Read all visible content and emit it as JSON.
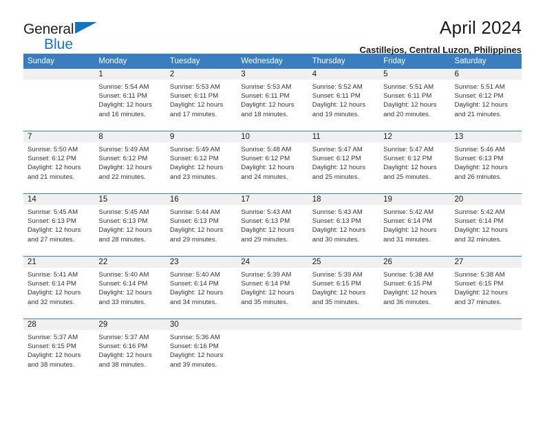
{
  "logo": {
    "word1": "General",
    "word2": "Blue",
    "triangle_icon": "triangle-icon",
    "color_general": "#231f20",
    "color_blue": "#1277c0"
  },
  "header": {
    "title": "April 2024",
    "subtitle": "Castillejos, Central Luzon, Philippines"
  },
  "colors": {
    "header_row_bg": "#3a7ebf",
    "daynum_strip_bg": "#f0f0f0",
    "week_separator": "#3a7ebf"
  },
  "weekdays": [
    "Sunday",
    "Monday",
    "Tuesday",
    "Wednesday",
    "Thursday",
    "Friday",
    "Saturday"
  ],
  "weeks": [
    [
      {
        "day": "",
        "sunrise": "",
        "sunset": "",
        "daylight1": "",
        "daylight2": ""
      },
      {
        "day": "1",
        "sunrise": "Sunrise: 5:54 AM",
        "sunset": "Sunset: 6:11 PM",
        "daylight1": "Daylight: 12 hours",
        "daylight2": "and 16 minutes."
      },
      {
        "day": "2",
        "sunrise": "Sunrise: 5:53 AM",
        "sunset": "Sunset: 6:11 PM",
        "daylight1": "Daylight: 12 hours",
        "daylight2": "and 17 minutes."
      },
      {
        "day": "3",
        "sunrise": "Sunrise: 5:53 AM",
        "sunset": "Sunset: 6:11 PM",
        "daylight1": "Daylight: 12 hours",
        "daylight2": "and 18 minutes."
      },
      {
        "day": "4",
        "sunrise": "Sunrise: 5:52 AM",
        "sunset": "Sunset: 6:11 PM",
        "daylight1": "Daylight: 12 hours",
        "daylight2": "and 19 minutes."
      },
      {
        "day": "5",
        "sunrise": "Sunrise: 5:51 AM",
        "sunset": "Sunset: 6:11 PM",
        "daylight1": "Daylight: 12 hours",
        "daylight2": "and 20 minutes."
      },
      {
        "day": "6",
        "sunrise": "Sunrise: 5:51 AM",
        "sunset": "Sunset: 6:12 PM",
        "daylight1": "Daylight: 12 hours",
        "daylight2": "and 21 minutes."
      }
    ],
    [
      {
        "day": "7",
        "sunrise": "Sunrise: 5:50 AM",
        "sunset": "Sunset: 6:12 PM",
        "daylight1": "Daylight: 12 hours",
        "daylight2": "and 21 minutes."
      },
      {
        "day": "8",
        "sunrise": "Sunrise: 5:49 AM",
        "sunset": "Sunset: 6:12 PM",
        "daylight1": "Daylight: 12 hours",
        "daylight2": "and 22 minutes."
      },
      {
        "day": "9",
        "sunrise": "Sunrise: 5:49 AM",
        "sunset": "Sunset: 6:12 PM",
        "daylight1": "Daylight: 12 hours",
        "daylight2": "and 23 minutes."
      },
      {
        "day": "10",
        "sunrise": "Sunrise: 5:48 AM",
        "sunset": "Sunset: 6:12 PM",
        "daylight1": "Daylight: 12 hours",
        "daylight2": "and 24 minutes."
      },
      {
        "day": "11",
        "sunrise": "Sunrise: 5:47 AM",
        "sunset": "Sunset: 6:12 PM",
        "daylight1": "Daylight: 12 hours",
        "daylight2": "and 25 minutes."
      },
      {
        "day": "12",
        "sunrise": "Sunrise: 5:47 AM",
        "sunset": "Sunset: 6:12 PM",
        "daylight1": "Daylight: 12 hours",
        "daylight2": "and 25 minutes."
      },
      {
        "day": "13",
        "sunrise": "Sunrise: 5:46 AM",
        "sunset": "Sunset: 6:13 PM",
        "daylight1": "Daylight: 12 hours",
        "daylight2": "and 26 minutes."
      }
    ],
    [
      {
        "day": "14",
        "sunrise": "Sunrise: 5:45 AM",
        "sunset": "Sunset: 6:13 PM",
        "daylight1": "Daylight: 12 hours",
        "daylight2": "and 27 minutes."
      },
      {
        "day": "15",
        "sunrise": "Sunrise: 5:45 AM",
        "sunset": "Sunset: 6:13 PM",
        "daylight1": "Daylight: 12 hours",
        "daylight2": "and 28 minutes."
      },
      {
        "day": "16",
        "sunrise": "Sunrise: 5:44 AM",
        "sunset": "Sunset: 6:13 PM",
        "daylight1": "Daylight: 12 hours",
        "daylight2": "and 29 minutes."
      },
      {
        "day": "17",
        "sunrise": "Sunrise: 5:43 AM",
        "sunset": "Sunset: 6:13 PM",
        "daylight1": "Daylight: 12 hours",
        "daylight2": "and 29 minutes."
      },
      {
        "day": "18",
        "sunrise": "Sunrise: 5:43 AM",
        "sunset": "Sunset: 6:13 PM",
        "daylight1": "Daylight: 12 hours",
        "daylight2": "and 30 minutes."
      },
      {
        "day": "19",
        "sunrise": "Sunrise: 5:42 AM",
        "sunset": "Sunset: 6:14 PM",
        "daylight1": "Daylight: 12 hours",
        "daylight2": "and 31 minutes."
      },
      {
        "day": "20",
        "sunrise": "Sunrise: 5:42 AM",
        "sunset": "Sunset: 6:14 PM",
        "daylight1": "Daylight: 12 hours",
        "daylight2": "and 32 minutes."
      }
    ],
    [
      {
        "day": "21",
        "sunrise": "Sunrise: 5:41 AM",
        "sunset": "Sunset: 6:14 PM",
        "daylight1": "Daylight: 12 hours",
        "daylight2": "and 32 minutes."
      },
      {
        "day": "22",
        "sunrise": "Sunrise: 5:40 AM",
        "sunset": "Sunset: 6:14 PM",
        "daylight1": "Daylight: 12 hours",
        "daylight2": "and 33 minutes."
      },
      {
        "day": "23",
        "sunrise": "Sunrise: 5:40 AM",
        "sunset": "Sunset: 6:14 PM",
        "daylight1": "Daylight: 12 hours",
        "daylight2": "and 34 minutes."
      },
      {
        "day": "24",
        "sunrise": "Sunrise: 5:39 AM",
        "sunset": "Sunset: 6:14 PM",
        "daylight1": "Daylight: 12 hours",
        "daylight2": "and 35 minutes."
      },
      {
        "day": "25",
        "sunrise": "Sunrise: 5:39 AM",
        "sunset": "Sunset: 6:15 PM",
        "daylight1": "Daylight: 12 hours",
        "daylight2": "and 35 minutes."
      },
      {
        "day": "26",
        "sunrise": "Sunrise: 5:38 AM",
        "sunset": "Sunset: 6:15 PM",
        "daylight1": "Daylight: 12 hours",
        "daylight2": "and 36 minutes."
      },
      {
        "day": "27",
        "sunrise": "Sunrise: 5:38 AM",
        "sunset": "Sunset: 6:15 PM",
        "daylight1": "Daylight: 12 hours",
        "daylight2": "and 37 minutes."
      }
    ],
    [
      {
        "day": "28",
        "sunrise": "Sunrise: 5:37 AM",
        "sunset": "Sunset: 6:15 PM",
        "daylight1": "Daylight: 12 hours",
        "daylight2": "and 38 minutes."
      },
      {
        "day": "29",
        "sunrise": "Sunrise: 5:37 AM",
        "sunset": "Sunset: 6:16 PM",
        "daylight1": "Daylight: 12 hours",
        "daylight2": "and 38 minutes."
      },
      {
        "day": "30",
        "sunrise": "Sunrise: 5:36 AM",
        "sunset": "Sunset: 6:16 PM",
        "daylight1": "Daylight: 12 hours",
        "daylight2": "and 39 minutes."
      },
      {
        "day": "",
        "sunrise": "",
        "sunset": "",
        "daylight1": "",
        "daylight2": ""
      },
      {
        "day": "",
        "sunrise": "",
        "sunset": "",
        "daylight1": "",
        "daylight2": ""
      },
      {
        "day": "",
        "sunrise": "",
        "sunset": "",
        "daylight1": "",
        "daylight2": ""
      },
      {
        "day": "",
        "sunrise": "",
        "sunset": "",
        "daylight1": "",
        "daylight2": ""
      }
    ]
  ]
}
